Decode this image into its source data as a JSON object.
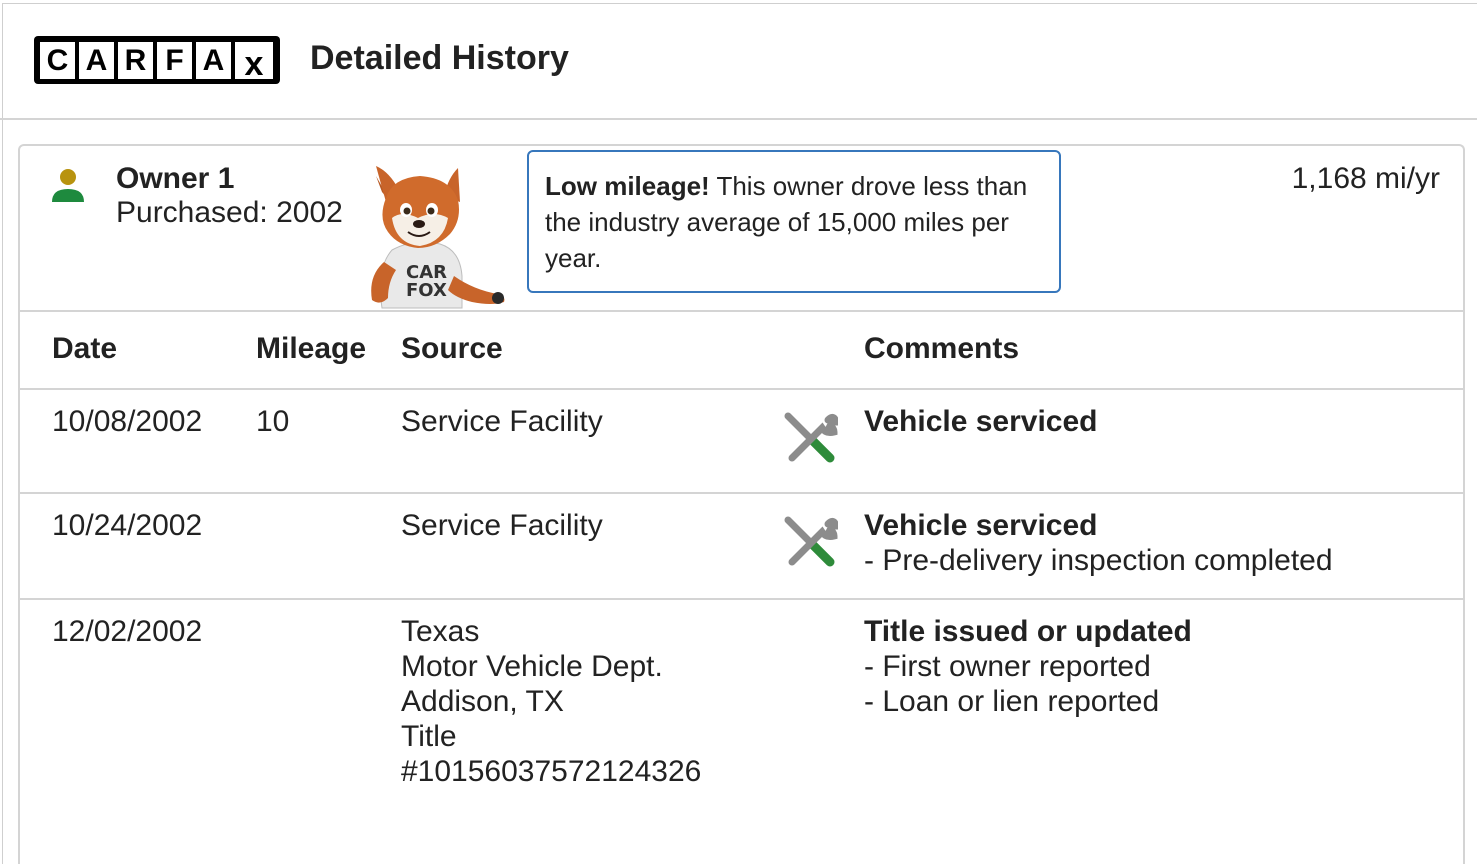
{
  "header": {
    "logo_letters": [
      "C",
      "A",
      "R",
      "F",
      "A",
      "x"
    ],
    "title": "Detailed History"
  },
  "owner": {
    "name": "Owner 1",
    "purchased": "Purchased: 2002",
    "mileage_rate": "1,168 mi/yr",
    "icon": "person-icon",
    "mascot_shirt": "CAR FOX"
  },
  "callout": {
    "bold": "Low mileage!",
    "text": " This owner drove less than the industry average of 15,000 miles per year."
  },
  "table": {
    "columns": [
      "Date",
      "Mileage",
      "Source",
      "Comments"
    ],
    "rows": [
      {
        "date": "10/08/2002",
        "mileage": "10",
        "source": [
          "Service Facility"
        ],
        "icon": "service-wrench-icon",
        "comment_title": "Vehicle serviced",
        "comment_items": []
      },
      {
        "date": "10/24/2002",
        "mileage": "",
        "source": [
          "Service Facility"
        ],
        "icon": "service-wrench-icon",
        "comment_title": "Vehicle serviced",
        "comment_items": [
          "- Pre-delivery inspection completed"
        ]
      },
      {
        "date": "12/02/2002",
        "mileage": "",
        "source": [
          "Texas",
          "Motor Vehicle Dept.",
          "Addison, TX",
          "Title",
          "#10156037572124326"
        ],
        "icon": "",
        "comment_title": "Title issued or updated",
        "comment_items": [
          "- First owner reported",
          "- Loan or lien reported"
        ]
      }
    ]
  },
  "colors": {
    "callout_border": "#3777bc",
    "owner_head": "#b8930f",
    "owner_body": "#1e8a3e",
    "wrench_gray": "#8c8c8c",
    "screwdriver_green": "#2e8b3a"
  }
}
